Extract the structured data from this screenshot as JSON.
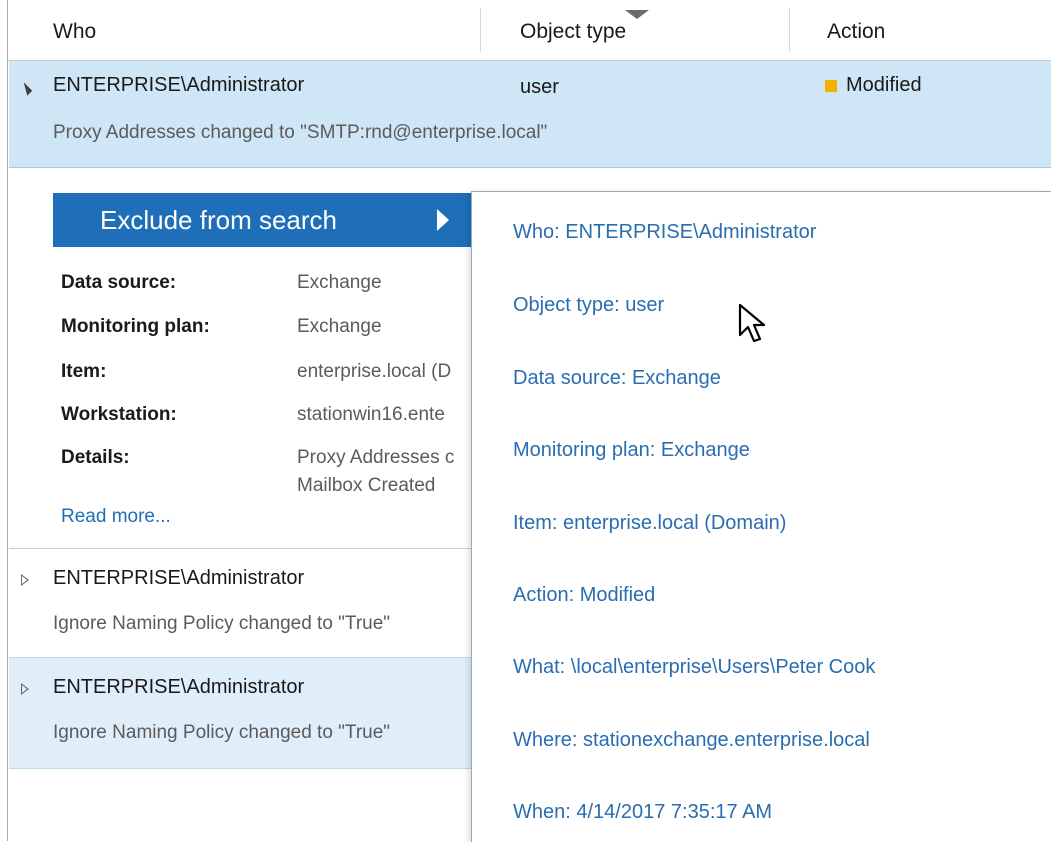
{
  "columns": {
    "who": "Who",
    "object_type": "Object type",
    "action": "Action"
  },
  "selected_row": {
    "who": "ENTERPRISE\\Administrator",
    "object_type": "user",
    "action": "Modified",
    "action_color": "#f2b100",
    "summary": "Proxy Addresses changed to \"SMTP:rnd@enterprise.local\""
  },
  "detail": {
    "exclude_button": "Exclude from search",
    "fields": [
      {
        "label": "Data source:",
        "value": "Exchange"
      },
      {
        "label": "Monitoring plan:",
        "value": "Exchange"
      },
      {
        "label": "Item:",
        "value": "enterprise.local (D"
      },
      {
        "label": "Workstation:",
        "value": "stationwin16.ente"
      },
      {
        "label": "Details:",
        "value": "Proxy Addresses c",
        "value2": "Mailbox Created"
      }
    ],
    "read_more": "Read more..."
  },
  "rows": [
    {
      "who": "ENTERPRISE\\Administrator",
      "summary": "Ignore Naming Policy changed to \"True\""
    },
    {
      "who": "ENTERPRISE\\Administrator",
      "summary": "Ignore Naming Policy changed to \"True\""
    }
  ],
  "popup_menu": {
    "items": [
      "Who: ENTERPRISE\\Administrator",
      "Object type: user",
      "Data source: Exchange",
      "Monitoring plan: Exchange",
      "Item: enterprise.local (Domain)",
      "Action: Modified",
      "What: \\local\\enterprise\\Users\\Peter Cook",
      "Where: stationexchange.enterprise.local",
      "When: 4/14/2017 7:35:17 AM"
    ]
  },
  "colors": {
    "accent": "#1e6fb8",
    "selected_row": "#cfe6f7",
    "alt_row": "#e0eefa",
    "link": "#2a6db0"
  }
}
